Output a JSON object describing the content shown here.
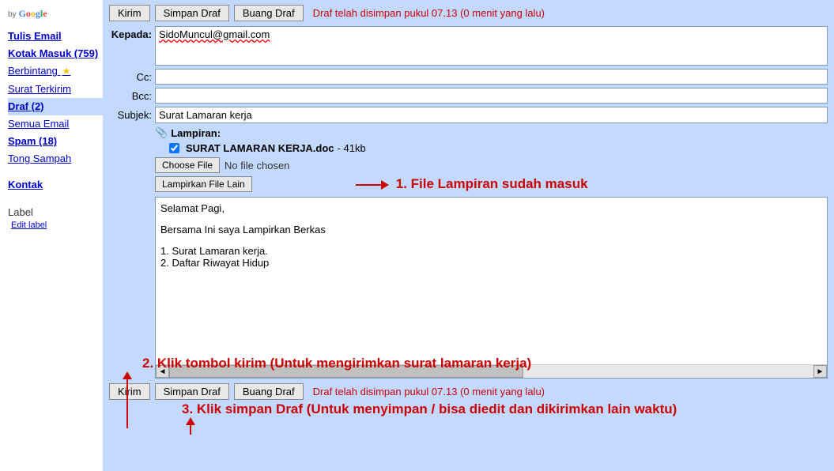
{
  "logo": {
    "by": "by",
    "g": "Google"
  },
  "sidebar": {
    "compose": "Tulis Email",
    "inbox": "Kotak Masuk (759)",
    "starred": "Berbintang",
    "sent": "Surat Terkirim",
    "drafts": "Draf (2)",
    "allmail": "Semua Email",
    "spam": "Spam (18)",
    "trash": "Tong Sampah",
    "contacts": "Kontak",
    "label_hdr": "Label",
    "edit_label": "Edit label"
  },
  "toolbar": {
    "send": "Kirim",
    "save": "Simpan Draf",
    "discard": "Buang Draf",
    "status": "Draf telah disimpan pukul 07.13 (0 menit yang lalu)"
  },
  "fields": {
    "to_label": "Kepada:",
    "to_value": "SidoMuncul@gmail.com",
    "cc_label": "Cc:",
    "cc_value": "",
    "bcc_label": "Bcc:",
    "bcc_value": "",
    "subject_label": "Subjek:",
    "subject_value": "Surat Lamaran kerja"
  },
  "attach": {
    "header": "Lampiran:",
    "file_name": "SURAT LAMARAN KERJA.doc",
    "file_size": " - 41kb",
    "choose": "Choose File",
    "nofile": "No file chosen",
    "more": "Lampirkan File Lain"
  },
  "body": {
    "greeting": "Selamat Pagi,",
    "line1": "Bersama Ini saya Lampirkan Berkas",
    "list1": "1. Surat Lamaran kerja.",
    "list2": "2. Daftar Riwayat Hidup"
  },
  "annotations": {
    "a1": "1. File Lampiran sudah masuk",
    "a2": "2. Klik tombol kirim (Untuk mengirimkan surat lamaran kerja)",
    "a3": "3. Klik simpan Draf (Untuk menyimpan / bisa diedit dan dikirimkan lain waktu)"
  }
}
